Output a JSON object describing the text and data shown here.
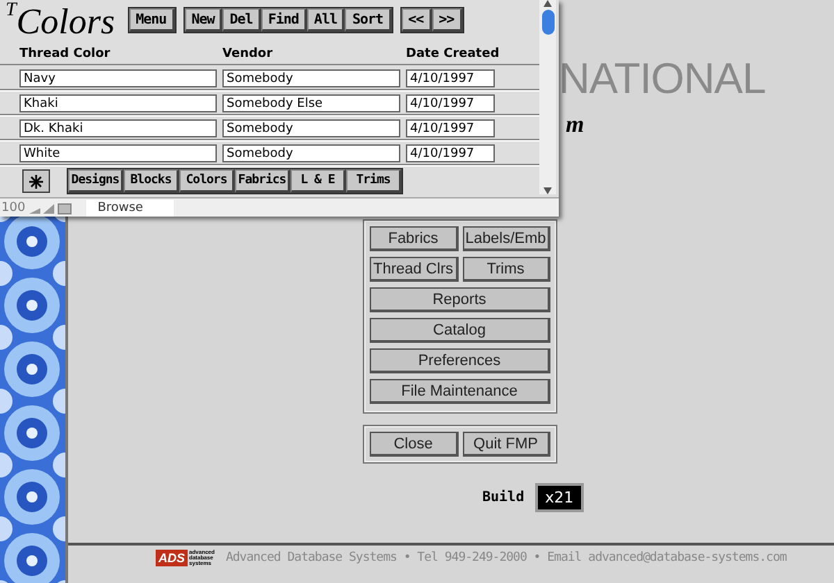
{
  "window": {
    "title_mark": "T",
    "title": "Colors",
    "toolbar": [
      [
        "Menu"
      ],
      [
        "New",
        "Del",
        "Find",
        "All",
        "Sort"
      ],
      [
        "<<",
        ">>"
      ]
    ],
    "columns": [
      "Thread Color",
      "Vendor",
      "Date Created"
    ],
    "rows": [
      [
        "Navy",
        "Somebody",
        "4/10/1997"
      ],
      [
        "Khaki",
        "Somebody Else",
        "4/10/1997"
      ],
      [
        "Dk. Khaki",
        "Somebody",
        "4/10/1997"
      ],
      [
        "White",
        "Somebody",
        "4/10/1997"
      ]
    ],
    "tabs": [
      "Designs",
      "Blocks",
      "Colors",
      "Fabrics",
      "L & E",
      "Trims"
    ],
    "status": {
      "zoom": "100",
      "mode": "Browse"
    }
  },
  "background": {
    "heading": "NATIONAL",
    "subtitle": "m",
    "menu": [
      [
        "Fabrics",
        "Labels/Emb"
      ],
      [
        "Thread Clrs",
        "Trims"
      ],
      [
        "Reports"
      ],
      [
        "Catalog"
      ],
      [
        "Preferences"
      ],
      [
        "File Maintenance"
      ]
    ],
    "exit_buttons": [
      "Close",
      "Quit FMP"
    ],
    "build": {
      "label": "Build",
      "value": "x21"
    },
    "footer": {
      "logo": "ADS",
      "logo_words": [
        "advanced",
        "database",
        "systems"
      ],
      "contact": "Advanced Database Systems • Tel 949-249-2000 • Email advanced@database-systems.com"
    }
  }
}
